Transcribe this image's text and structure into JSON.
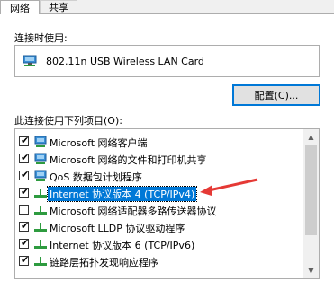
{
  "tabs": [
    {
      "label": "网络",
      "active": true
    },
    {
      "label": "共享",
      "active": false
    }
  ],
  "connect_using_label": "连接时使用:",
  "adapter": {
    "name": "802.11n USB Wireless LAN Card",
    "icon": "network-adapter-icon"
  },
  "configure_button": "配置(C)...",
  "items_label": "此连接使用下列项目(O):",
  "items": [
    {
      "label": "Microsoft 网络客户端",
      "checked": true,
      "icon": "network-client-icon"
    },
    {
      "label": "Microsoft 网络的文件和打印机共享",
      "checked": true,
      "icon": "network-client-icon"
    },
    {
      "label": "QoS 数据包计划程序",
      "checked": true,
      "icon": "network-client-icon"
    },
    {
      "label": "Internet 协议版本 4 (TCP/IPv4)",
      "checked": true,
      "selected": true,
      "icon": "protocol-icon"
    },
    {
      "label": "Microsoft 网络适配器多路传送器协议",
      "checked": false,
      "icon": "protocol-icon"
    },
    {
      "label": "Microsoft LLDP 协议驱动程序",
      "checked": true,
      "icon": "protocol-icon"
    },
    {
      "label": "Internet 协议版本 6 (TCP/IPv6)",
      "checked": true,
      "icon": "protocol-icon"
    },
    {
      "label": "链路层拓扑发现响应程序",
      "checked": true,
      "icon": "protocol-icon"
    }
  ],
  "colors": {
    "selection": "#0078d7",
    "arrow": "#e53935",
    "accent": "#0078d7"
  }
}
